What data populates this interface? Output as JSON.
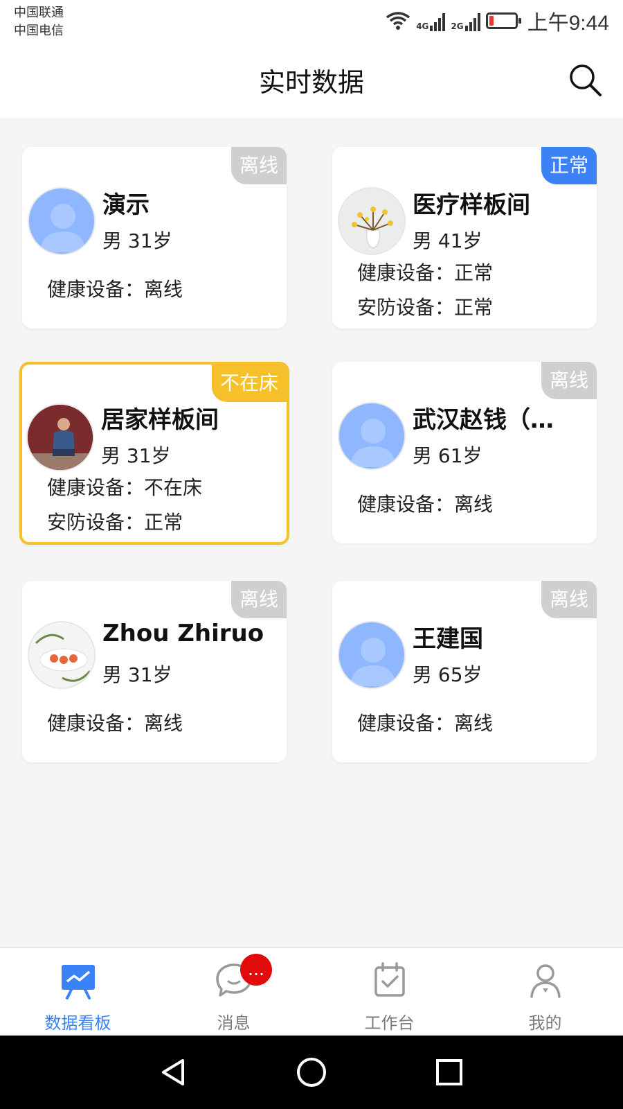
{
  "status_bar": {
    "carrier1": "中国联通",
    "carrier2": "中国电信",
    "net1": "4G",
    "net2": "2G",
    "time": "上午9:44"
  },
  "header": {
    "title": "实时数据"
  },
  "cards": [
    {
      "name": "演示",
      "meta": "男 31岁",
      "status": "离线",
      "status_type": "offline",
      "avatar": "default-avatar",
      "health": "健康设备：离线",
      "security": ""
    },
    {
      "name": "医疗样板间",
      "meta": "男 41岁",
      "status": "正常",
      "status_type": "normal",
      "avatar": "vase-photo",
      "health": "健康设备：正常",
      "security": "安防设备：正常"
    },
    {
      "name": "居家样板间",
      "meta": "男 31岁",
      "status": "不在床",
      "status_type": "notinbed",
      "avatar": "man-sitting-photo",
      "health": "健康设备：不在床",
      "security": "安防设备：正常"
    },
    {
      "name": "武汉赵钱（…",
      "meta": "男 61岁",
      "status": "离线",
      "status_type": "offline",
      "avatar": "default-avatar",
      "health": "健康设备：离线",
      "security": ""
    },
    {
      "name": "Zhou Zhiruo",
      "meta": "男 31岁",
      "status": "离线",
      "status_type": "offline",
      "avatar": "food-photo",
      "health": "健康设备：离线",
      "security": ""
    },
    {
      "name": "王建国",
      "meta": "男 65岁",
      "status": "离线",
      "status_type": "offline",
      "avatar": "default-avatar",
      "health": "健康设备：离线",
      "security": ""
    }
  ],
  "bottom_nav": {
    "items": [
      {
        "label": "数据看板",
        "icon": "dashboard-icon",
        "active": true
      },
      {
        "label": "消息",
        "icon": "message-icon",
        "active": false,
        "badge": "…"
      },
      {
        "label": "工作台",
        "icon": "workbench-icon",
        "active": false
      },
      {
        "label": "我的",
        "icon": "profile-icon",
        "active": false
      }
    ]
  },
  "colors": {
    "accent": "#3b82f6",
    "offline": "#cfcfcf",
    "warning": "#f5c02a",
    "badge": "#e10b0b"
  }
}
